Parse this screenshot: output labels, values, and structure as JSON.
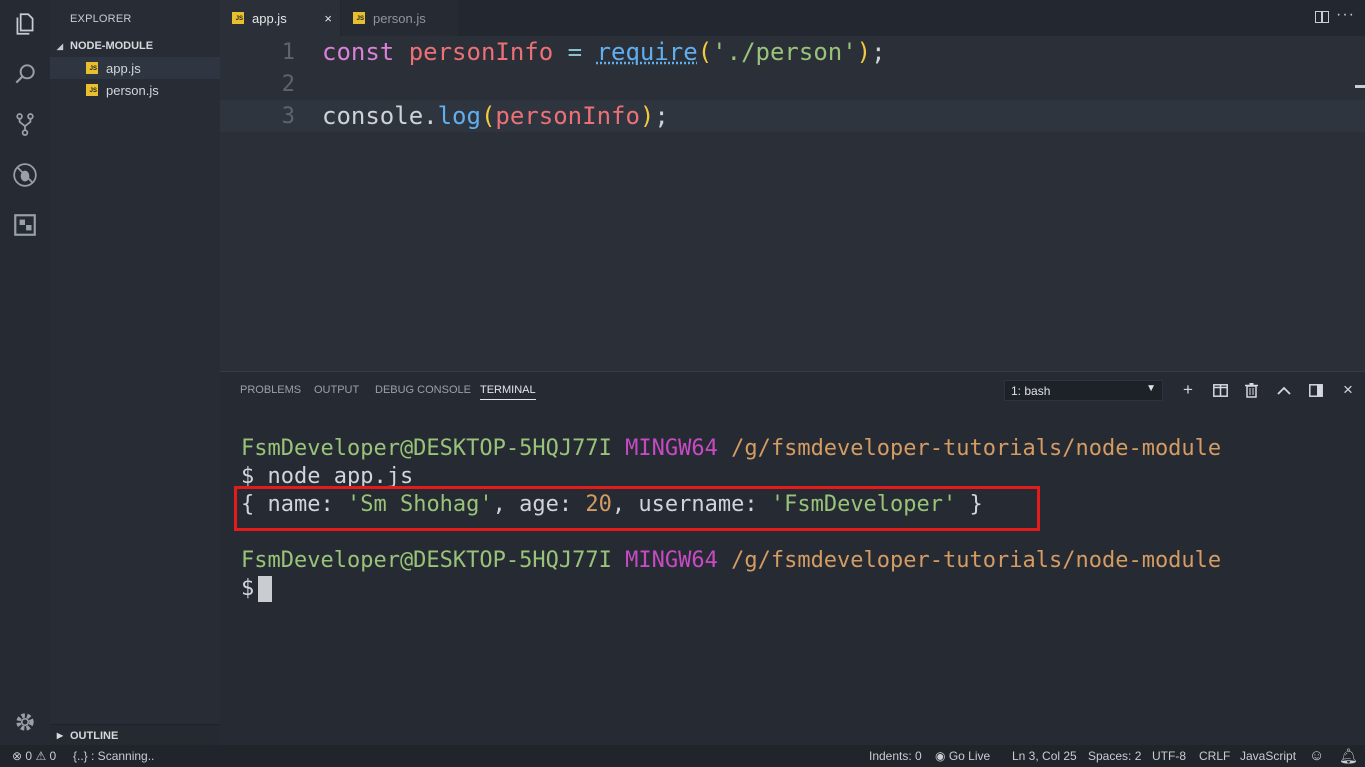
{
  "sidebar": {
    "title": "EXPLORER",
    "folder": "NODE-MODULE",
    "files": [
      {
        "name": "app.js",
        "badge": "JS"
      },
      {
        "name": "person.js",
        "badge": "JS"
      }
    ],
    "outline": "OUTLINE"
  },
  "tabs": [
    {
      "label": "app.js",
      "badge": "JS",
      "close": "×"
    },
    {
      "label": "person.js",
      "badge": "JS"
    }
  ],
  "editor": {
    "lines": [
      {
        "num": "1",
        "t1": "const",
        "t2": "personInfo",
        "t3": "=",
        "t4": "require",
        "t5": "(",
        "t6": "'./person'",
        "t7": ")",
        "t8": ";"
      },
      {
        "num": "2"
      },
      {
        "num": "3",
        "t1": "console",
        "t2": ".",
        "t3": "log",
        "t4": "(",
        "t5": "personInfo",
        "t6": ")",
        "t7": ";"
      }
    ]
  },
  "panel": {
    "tabs": [
      "PROBLEMS",
      "OUTPUT",
      "DEBUG CONSOLE",
      "TERMINAL"
    ],
    "active_tab": "TERMINAL",
    "shell_select": "1: bash",
    "caret": "▼",
    "icons": {
      "add": "+",
      "delete": "🗑",
      "up": "︿",
      "close": "×"
    }
  },
  "terminal": {
    "prompt_user": "FsmDeveloper@DESKTOP-5HQJ77I",
    "prompt_env": "MINGW64",
    "prompt_path": "/g/fsmdeveloper-tutorials/node-module",
    "command": "$ node app.js",
    "output": {
      "open": "{ name: ",
      "name_val": "'Sm Shohag'",
      "age_key": ", age: ",
      "age_val": "20",
      "user_key": ", username: ",
      "user_val": "'FsmDeveloper'",
      "close": " }"
    },
    "prompt2_user": "FsmDeveloper@DESKTOP-5HQJ77I",
    "prompt2_env": "MINGW64",
    "prompt2_path": "/g/fsmdeveloper-tutorials/node-module",
    "dollar": "$"
  },
  "status": {
    "errors": "0",
    "warnings": "0",
    "scanning": "{..} : Scanning..",
    "indents": "Indents: 0",
    "go_live": "Go Live",
    "position": "Ln 3, Col 25",
    "spaces": "Spaces: 2",
    "encoding": "UTF-8",
    "eol": "CRLF",
    "language": "JavaScript"
  }
}
